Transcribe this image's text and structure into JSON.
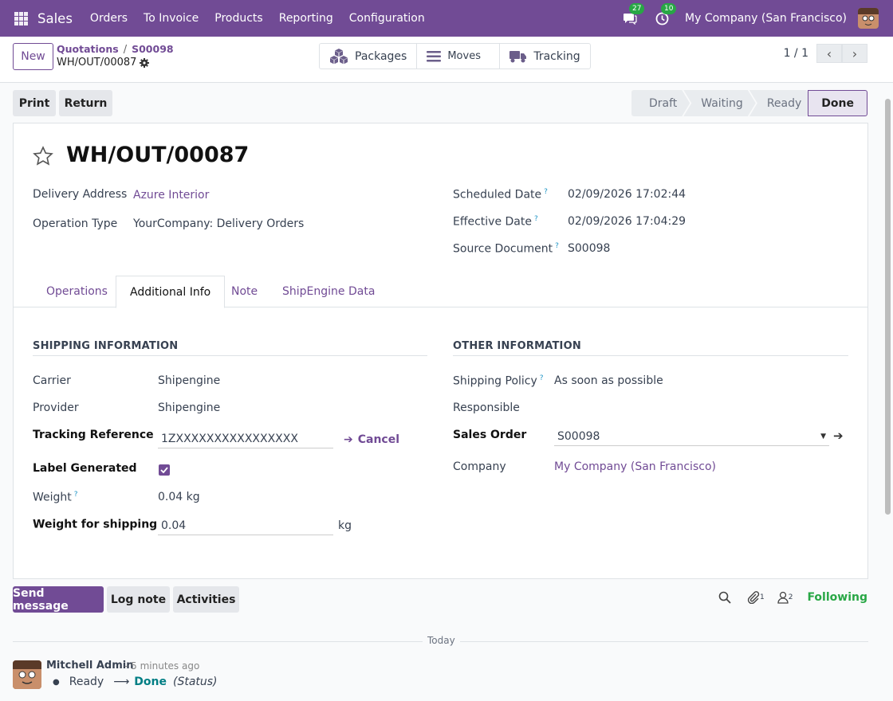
{
  "topbar": {
    "app_name": "Sales",
    "menu": [
      "Orders",
      "To Invoice",
      "Products",
      "Reporting",
      "Configuration"
    ],
    "messages_count": "27",
    "activities_count": "10",
    "company": "My Company (San Francisco)"
  },
  "controlpanel": {
    "new_label": "New",
    "breadcrumb": [
      "Quotations",
      "S00098"
    ],
    "breadcrumb_sep": "/",
    "current": "WH/OUT/00087",
    "smart_buttons": [
      "Packages",
      "Moves",
      "Tracking"
    ],
    "pager": "1 / 1"
  },
  "actions": {
    "print": "Print",
    "return": "Return",
    "status": [
      "Draft",
      "Waiting",
      "Ready",
      "Done"
    ],
    "status_active": "Done"
  },
  "record": {
    "title": "WH/OUT/00087",
    "delivery_address_label": "Delivery Address",
    "delivery_address": "Azure Interior",
    "operation_type_label": "Operation Type",
    "operation_type": "YourCompany: Delivery Orders",
    "scheduled_date_label": "Scheduled Date",
    "scheduled_date": "02/09/2026 17:02:44",
    "effective_date_label": "Effective Date",
    "effective_date": "02/09/2026 17:04:29",
    "source_document_label": "Source Document",
    "source_document": "S00098",
    "help_mark": "?"
  },
  "tabs": [
    "Operations",
    "Additional Info",
    "Note",
    "ShipEngine Data"
  ],
  "shipping": {
    "section": "SHIPPING INFORMATION",
    "carrier_label": "Carrier",
    "carrier": "Shipengine",
    "provider_label": "Provider",
    "provider": "Shipengine",
    "tracking_ref_label": "Tracking Reference",
    "tracking_ref": "1ZXXXXXXXXXXXXXXXX",
    "cancel_label": "Cancel",
    "label_generated_label": "Label Generated",
    "label_generated": true,
    "weight_label": "Weight",
    "weight": "0.04",
    "weight_unit": "kg",
    "weight_shipping_label": "Weight for shipping",
    "weight_shipping": "0.04",
    "weight_shipping_unit": "kg"
  },
  "other": {
    "section": "OTHER INFORMATION",
    "shipping_policy_label": "Shipping Policy",
    "shipping_policy": "As soon as possible",
    "responsible_label": "Responsible",
    "sales_order_label": "Sales Order",
    "sales_order": "S00098",
    "company_label": "Company",
    "company": "My Company (San Francisco)"
  },
  "chatter": {
    "send_message": "Send message",
    "log_note": "Log note",
    "activities": "Activities",
    "attachments_count": "1",
    "followers_count": "2",
    "following": "Following",
    "today": "Today",
    "author": "Mitchell Admin",
    "time": "- 5 minutes ago",
    "old_status": "Ready",
    "new_status": "Done",
    "field": "(Status)"
  },
  "colors": {
    "brand": "#714b95",
    "following": "#28a745",
    "badge": "#28a745",
    "help": "#2196c6"
  }
}
